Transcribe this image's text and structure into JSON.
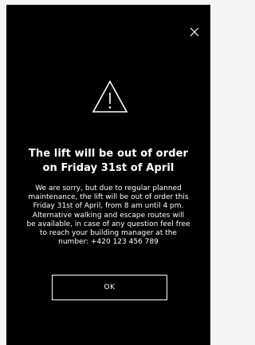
{
  "dialog": {
    "close_icon": "close-icon",
    "warning_icon": "warning-icon",
    "title_lines": [
      "The lift will be out of order",
      "on Friday 31st of April"
    ],
    "message_lines": [
      "We are sorry,  but due to regular planned",
      "maintenance, the lift will be out of order this",
      "Friday 31st of April, from 8 am until 4 pm.",
      "Alternative walking and escape routes will",
      "be available, in case of any question feel free",
      "to reach your building manager at the",
      "number: +420 123 456 789"
    ],
    "ok_label": "OK"
  },
  "colors": {
    "background": "#000000",
    "foreground": "#ffffff",
    "page": "#f4f4f4"
  }
}
